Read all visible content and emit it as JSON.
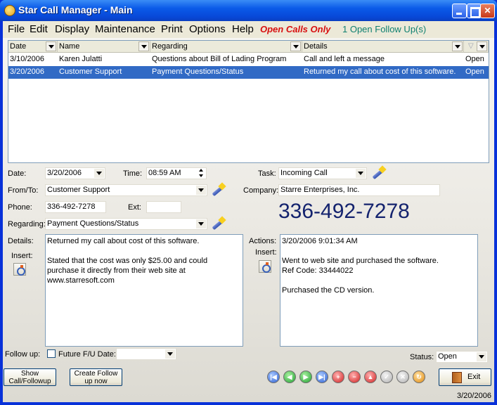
{
  "window": {
    "title": "Star Call Manager - Main"
  },
  "menu": {
    "items": [
      "File",
      "Edit",
      "Display",
      "Maintenance",
      "Print",
      "Options",
      "Help"
    ],
    "open_calls": "Open Calls Only",
    "followups": "1  Open Follow Up(s)"
  },
  "grid": {
    "columns": [
      "Date",
      "Name",
      "Regarding",
      "Details",
      ""
    ],
    "rows": [
      {
        "date": "3/10/2006",
        "name": "Karen Julatti",
        "regarding": "Questions about Bill of Lading Program",
        "details": "Call and left a message",
        "status": "Open",
        "selected": false
      },
      {
        "date": "3/20/2006",
        "name": "Customer Support",
        "regarding": "Payment Questions/Status",
        "details": "Returned my call about cost of this software.",
        "status": "Open",
        "selected": true
      }
    ]
  },
  "form": {
    "date_label": "Date:",
    "date_value": "3/20/2006",
    "time_label": "Time:",
    "time_value": "08:59 AM",
    "task_label": "Task:",
    "task_value": "Incoming Call",
    "fromto_label": "From/To:",
    "fromto_value": "Customer Support",
    "company_label": "Company:",
    "company_value": "Starre Enterprises, Inc.",
    "phone_label": "Phone:",
    "phone_value": "336-492-7278",
    "ext_label": "Ext:",
    "ext_value": "",
    "big_phone": "336-492-7278",
    "regarding_label": "Regarding:",
    "regarding_value": "Payment Questions/Status",
    "details_label": "Details:",
    "details_insert_label": "Insert:",
    "details_text": "Returned my call about cost of this software.\n\nStated that the cost was only $25.00 and could purchase it directly from their web site at www.starresoft.com",
    "actions_label": "Actions:",
    "actions_insert_label": "Insert:",
    "actions_text": "3/20/2006 9:01:34 AM\n\nWent to web site and purchased the software.\nRef Code: 33444022\n\nPurchased the CD version.",
    "followup_label": "Follow up:",
    "future_fu_label": "Future F/U Date:",
    "future_fu_value": "",
    "status_label": "Status:",
    "status_value": "Open"
  },
  "buttons": {
    "show_call": "Show Call/Followup",
    "create_followup": "Create Follow up now",
    "exit": "Exit"
  },
  "status_date": "3/20/2006"
}
